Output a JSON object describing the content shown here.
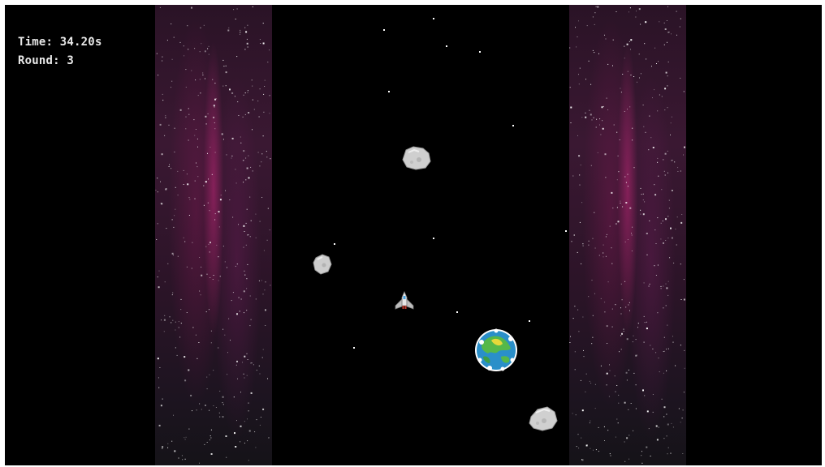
{
  "hud": {
    "time_label": "Time:",
    "time_value": "34.20s",
    "round_label": "Round:",
    "round_value": "3"
  },
  "colors": {
    "background": "#000000",
    "hud_text": "#e8e8e8",
    "nebula_accent": "#be2878"
  },
  "sprites": {
    "player": "spaceship-icon",
    "planet": "earth-planet-icon",
    "obstacle": "asteroid-icon"
  }
}
